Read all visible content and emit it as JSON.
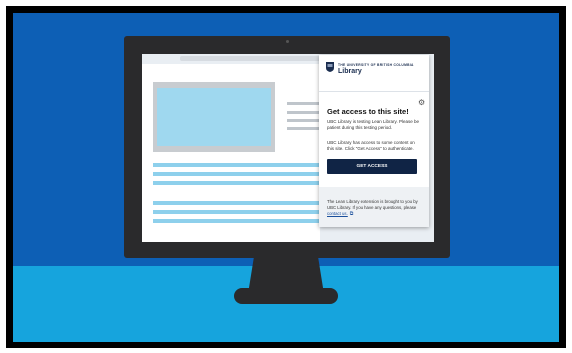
{
  "panel": {
    "university": "THE UNIVERSITY OF BRITISH COLUMBIA",
    "library": "Library",
    "title": "Get access to this site!",
    "body1": "UBC Library is testing Lean Library. Please be patient during this testing period.",
    "body2": "UBC Library has access to some content on this site. Click \"Get Access\" to authenticate.",
    "button_label": "GET ACCESS",
    "footer_text": "The Lean Library extension is brought to you by UBC Library. If you have any questions, please ",
    "footer_link": "contact us.",
    "footer_link_icon": "external-link-icon"
  },
  "colors": {
    "background_top": "#0d5fb5",
    "background_bottom": "#16a4dd",
    "monitor": "#2a2a2c",
    "button": "#102445",
    "image_placeholder": "#9fd8ef"
  }
}
